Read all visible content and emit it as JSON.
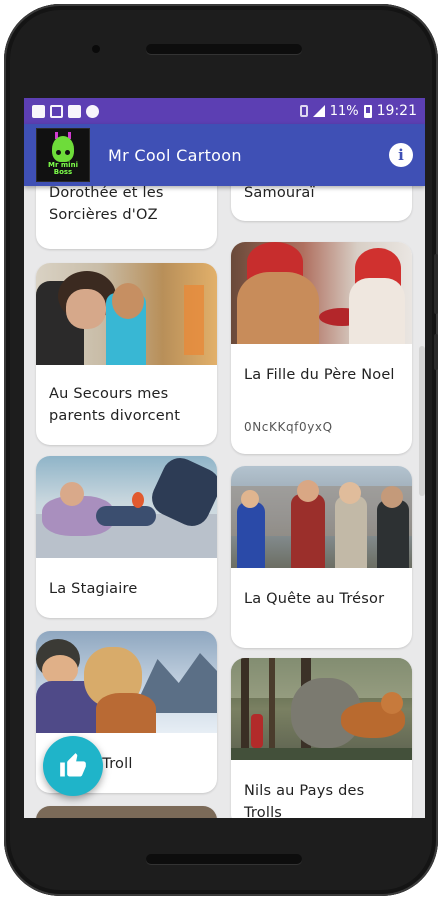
{
  "status_bar": {
    "battery": "11%",
    "time": "19:21"
  },
  "app": {
    "title": "Mr Cool Cartoon",
    "logo_text": "Mr mini\nBoss"
  },
  "cards": [
    {
      "title": "Dorothée et les Sorcières d'OZ"
    },
    {
      "title": "Samouraï"
    },
    {
      "title": "Au Secours mes parents divorcent"
    },
    {
      "title": "La Fille du Père Noel",
      "subtitle": "0NcKKqf0yxQ"
    },
    {
      "title": "La Stagiaire"
    },
    {
      "title": "La Quête au Trésor"
    },
    {
      "title": "Troli le Troll"
    },
    {
      "title": "Nils au Pays des Trolls"
    }
  ],
  "colors": {
    "status_bar": "#5c3fb3",
    "app_bar": "#3f50b5",
    "fab": "#1fb4c9",
    "background": "#e9e9ea"
  },
  "icons": {
    "info": "info-icon",
    "fab": "thumbs-up-icon"
  }
}
